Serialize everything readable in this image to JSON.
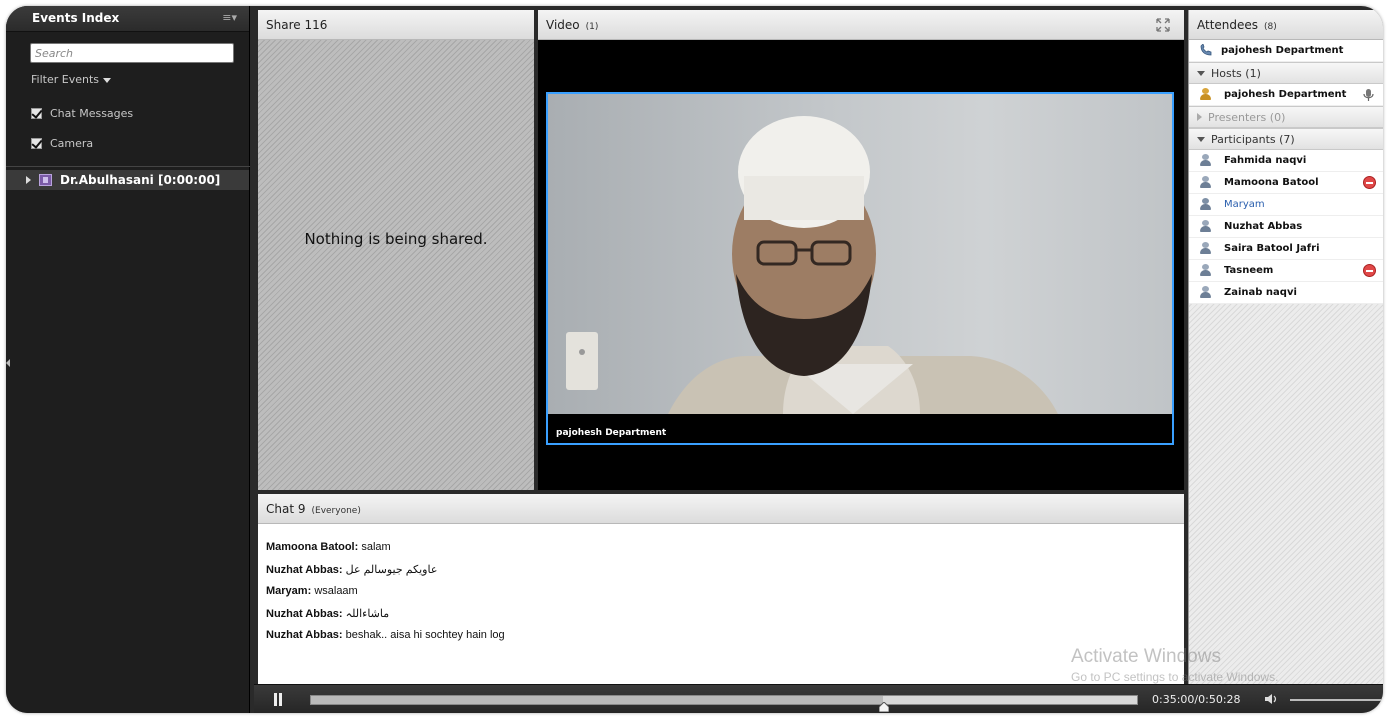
{
  "events": {
    "title": "Events Index",
    "search_placeholder": "Search",
    "filter_label": "Filter Events",
    "filters": [
      "Chat Messages",
      "Camera"
    ],
    "item": "Dr.Abulhasani [0:00:00]"
  },
  "share": {
    "title": "Share 116",
    "message": "Nothing is being shared."
  },
  "video": {
    "title": "Video",
    "count": "(1)",
    "feed_name": "pajohesh Department"
  },
  "chat": {
    "title": "Chat 9",
    "scope": "(Everyone)",
    "messages": [
      {
        "sender": "Mamoona Batool:",
        "text": "salam"
      },
      {
        "sender": "Nuzhat Abbas:",
        "text": "عاو‌یکم جیوسالم عل"
      },
      {
        "sender": "Maryam:",
        "text": "wsalaam"
      },
      {
        "sender": "Nuzhat Abbas:",
        "text": "ماشاءاللہ"
      },
      {
        "sender": "Nuzhat Abbas:",
        "text": "beshak.. aisa hi sochtey hain log"
      }
    ]
  },
  "attendees": {
    "title": "Attendees",
    "count": "(8)",
    "phone_user": "pajohesh Department",
    "hosts_label": "Hosts (1)",
    "hosts": [
      "pajohesh Department"
    ],
    "presenters_label": "Presenters (0)",
    "participants_label": "Participants (7)",
    "participants": [
      "Fahmida naqvi",
      "Mamoona Batool",
      "Maryam",
      "Nuzhat Abbas",
      "Saira Batool Jafri",
      "Tasneem",
      "Zainab naqvi"
    ]
  },
  "playback": {
    "time": "0:35:00/0:50:28",
    "progress": 0.693
  },
  "watermark": {
    "line1": "Activate Windows",
    "line2": "Go to PC settings to activate Windows."
  },
  "colors": {
    "accent_border": "#3aa0ff",
    "panel_dark": "#1e1e1e",
    "status_remove": "#e04848"
  }
}
